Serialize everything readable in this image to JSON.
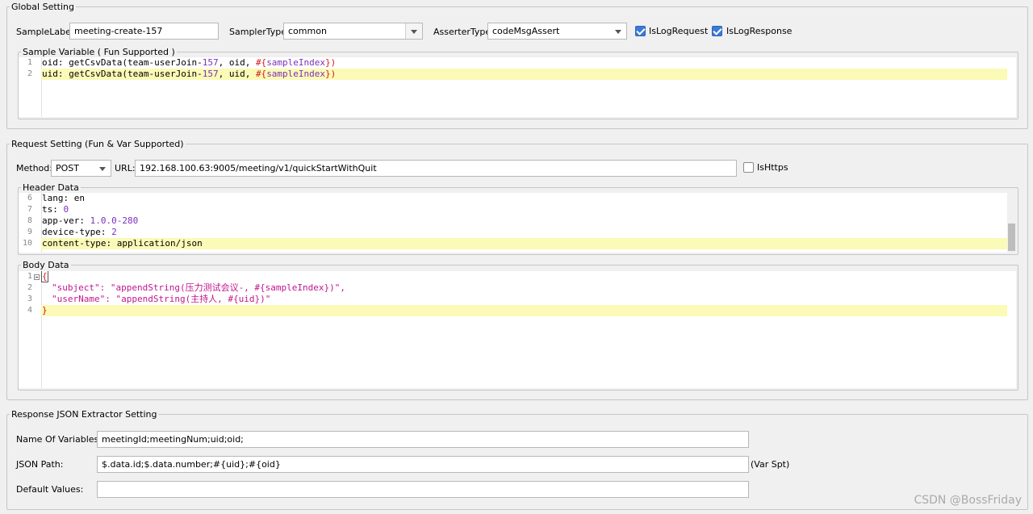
{
  "global_setting": {
    "legend": "Global Setting",
    "sample_label_label": "SampleLabel:",
    "sample_label_value": "meeting-create-157",
    "sampler_type_label": "SamplerType:",
    "sampler_type_value": "common",
    "asserter_type_label": "AsserterType:",
    "asserter_type_value": "codeMsgAssert",
    "is_log_request_label": "IsLogRequest",
    "is_log_request_checked": true,
    "is_log_response_label": "IsLogResponse",
    "is_log_response_checked": true,
    "sample_variable": {
      "legend": "Sample Variable ( Fun Supported )",
      "line_numbers": [
        "1",
        "2"
      ],
      "lines": [
        {
          "key": "oid: ",
          "fn": "getCsvData(",
          "arg1": "team-userJoin-",
          "arg1_num": "157",
          "rest": ", oid, ",
          "hash": "#{",
          "var": "sampleIndex",
          "close": "})"
        },
        {
          "key": "uid: ",
          "fn": "getCsvData(",
          "arg1": "team-userJoin-",
          "arg1_num": "157",
          "rest": ", uid, ",
          "hash": "#{",
          "var": "sampleIndex",
          "close": "})"
        }
      ]
    }
  },
  "request_setting": {
    "legend": "Request Setting (Fun & Var Supported)",
    "method_label": "Method:",
    "method_value": "POST",
    "url_label": "URL:",
    "url_value": "192.168.100.63:9005/meeting/v1/quickStartWithQuit",
    "is_https_label": "IsHttps",
    "is_https_checked": false,
    "header_data": {
      "legend": "Header Data",
      "line_numbers": [
        "6",
        "7",
        "8",
        "9",
        "10"
      ],
      "lines": [
        {
          "key": "lang",
          "sep": ": ",
          "value": "en"
        },
        {
          "key": "ts",
          "sep": ": ",
          "value": "0"
        },
        {
          "key": "app-ver",
          "sep": ": ",
          "value": "1.0.0-280"
        },
        {
          "key": "device-type",
          "sep": ": ",
          "value": "2"
        },
        {
          "key": "content-type",
          "sep": ": ",
          "value": "application/json"
        }
      ]
    },
    "body_data": {
      "legend": "Body Data",
      "line_numbers": [
        "1",
        "2",
        "3",
        "4"
      ],
      "open_brace": "{",
      "close_brace": "}",
      "line2": "\"subject\": \"appendString(压力测试会议-, #{sampleIndex})\",",
      "line3": "\"userName\": \"appendString(主持人, #{uid})\""
    }
  },
  "extractor_setting": {
    "legend": "Response JSON Extractor Setting",
    "names_label": "Name Of Variables:",
    "names_value": "meetingId;meetingNum;uid;oid;",
    "json_path_label": "JSON Path:",
    "json_path_value": "$.data.id;$.data.number;#{uid};#{oid}",
    "var_spt_label": "(Var Spt)",
    "default_values_label": "Default Values:",
    "default_values_value": ""
  },
  "watermark": "CSDN @BossFriday",
  "colors": {
    "background": "#f0f0f0",
    "highlight_line": "#fbfab6",
    "string": "#c0168f",
    "number": "#7b2fbf",
    "brace": "#d6181e",
    "checkbox": "#3b7bd6"
  }
}
